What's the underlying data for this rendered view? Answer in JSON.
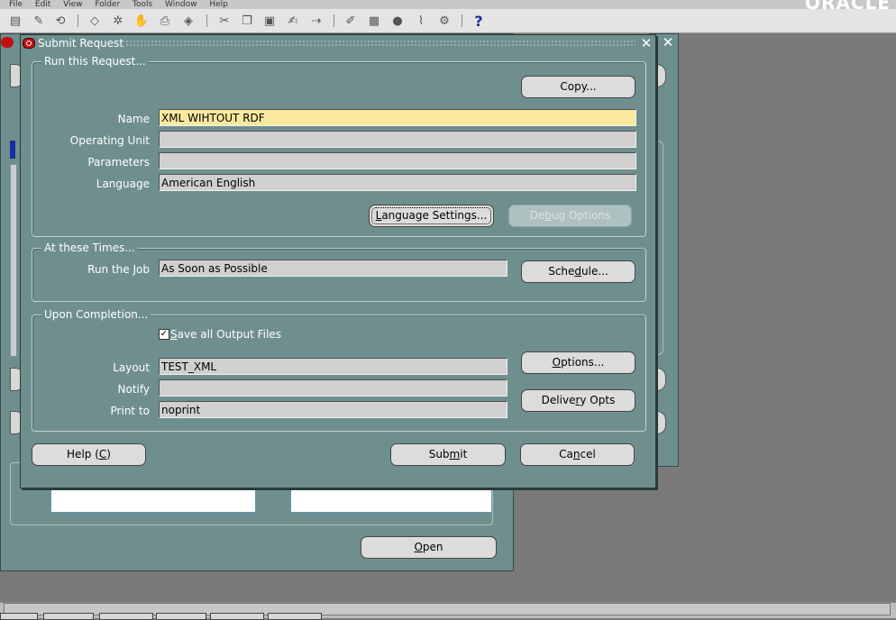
{
  "app": {
    "brand": "ORACLE"
  },
  "menu": [
    "File",
    "Edit",
    "View",
    "Folder",
    "Tools",
    "Window",
    "Help"
  ],
  "toolbar": {
    "icons": [
      "new-icon",
      "open-icon",
      "save-icon",
      "print-icon",
      "clear-icon",
      "delete-icon",
      "find-icon",
      "cut-icon",
      "copy-icon",
      "paste-icon",
      "edit-icon",
      "translate-icon",
      "zoom-icon",
      "attachment-icon",
      "folder-icon",
      "help-icon"
    ],
    "help_glyph": "?"
  },
  "dialog": {
    "title": "Submit Request",
    "run_group": {
      "title": "Run this Request...",
      "copy_button": "Copy...",
      "name_label": "Name",
      "name_value": "XML WIHTOUT RDF",
      "operating_unit_label": "Operating Unit",
      "operating_unit_value": "",
      "parameters_label": "Parameters",
      "parameters_value": "",
      "language_label": "Language",
      "language_value": "American English",
      "language_settings_button": {
        "pre": "",
        "mn": "L",
        "post": "anguage Settings..."
      },
      "debug_options_button": {
        "pre": "De",
        "mn": "b",
        "post": "ug Options"
      }
    },
    "times_group": {
      "title": "At these Times...",
      "run_job_label": "Run the Job",
      "run_job_value": "As Soon as Possible",
      "schedule_button": {
        "pre": "Sche",
        "mn": "d",
        "post": "ule..."
      }
    },
    "completion_group": {
      "title": "Upon Completion...",
      "save_output": {
        "checked": true,
        "pre": "",
        "mn": "S",
        "post": "ave all Output Files"
      },
      "layout_label": "Layout",
      "layout_value": "TEST_XML",
      "notify_label": "Notify",
      "notify_value": "",
      "print_to_label": "Print to",
      "print_to_value": "noprint",
      "options_button": {
        "pre": "",
        "mn": "O",
        "post": "ptions..."
      },
      "delivery_button": {
        "pre": "Delive",
        "mn": "r",
        "post": "y Opts"
      }
    },
    "help_button": {
      "pre": "Help (",
      "mn": "C",
      "post": ")"
    },
    "submit_button": {
      "pre": "Sub",
      "mn": "m",
      "post": "it"
    },
    "cancel_button": {
      "pre": "Ca",
      "mn": "n",
      "post": "cel"
    }
  },
  "navigator": {
    "open_button": {
      "pre": "",
      "mn": "O",
      "post": "pen"
    }
  },
  "colors": {
    "window_bg": "#6f8f8f",
    "desktop": "#7a7a7a",
    "active_field": "#fce9a0"
  }
}
